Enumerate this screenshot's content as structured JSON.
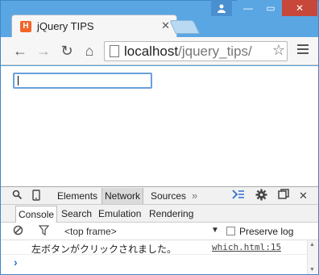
{
  "tab": {
    "title": "jQuery TIPS",
    "favicon_glyph": "H",
    "close_glyph": "✕",
    "icon": "html5-icon"
  },
  "window": {
    "user_icon": "user-icon",
    "minimize_glyph": "—",
    "maximize_glyph": "▭",
    "close_glyph": "✕"
  },
  "toolbar": {
    "back_glyph": "←",
    "forward_glyph": "→",
    "reload_glyph": "↻",
    "home_glyph": "⌂",
    "url_host": "localhost",
    "url_path": "/jquery_tips/",
    "star_glyph": "☆"
  },
  "page": {
    "input_value": ""
  },
  "devtools": {
    "tabs": [
      "Elements",
      "Network",
      "Sources"
    ],
    "more_glyph": "»",
    "subtabs": [
      "Console",
      "Search",
      "Emulation",
      "Rendering"
    ],
    "frame_selector": "<top frame>",
    "preserve_log_label": "Preserve log",
    "preserve_log_checked": false,
    "console_message": "左ボタンがクリックされました。",
    "console_source": "which.html:15",
    "prompt_glyph": "›"
  },
  "colors": {
    "frame": "#5aa6e3",
    "close_button": "#c7473a",
    "input_focus": "#6aa0dc",
    "prompt": "#2a6fd0"
  }
}
